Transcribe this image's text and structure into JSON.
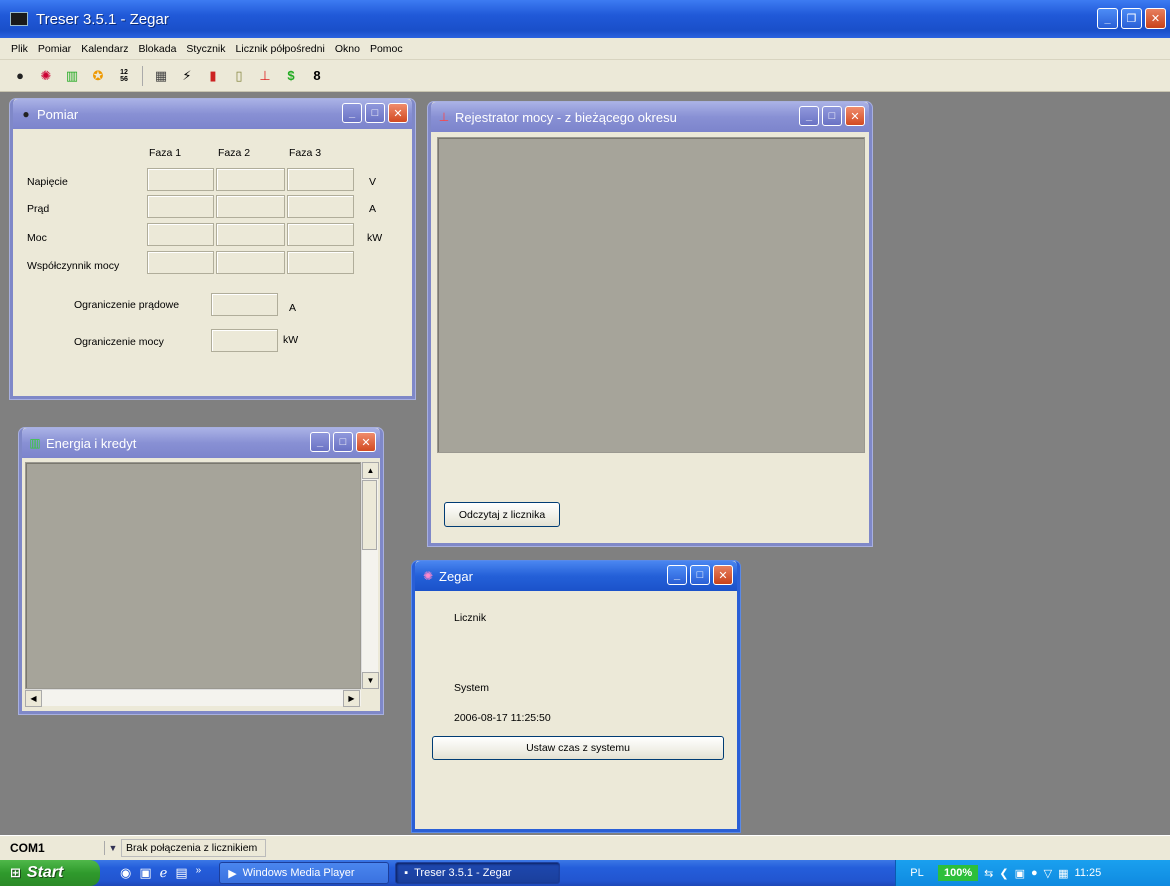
{
  "app": {
    "title": "Treser 3.5.1 - Zegar"
  },
  "menu": [
    "Plik",
    "Pomiar",
    "Kalendarz",
    "Blokada",
    "Stycznik",
    "Licznik półpośredni",
    "Okno",
    "Pomoc"
  ],
  "toolbar_icons": [
    "measure-icon",
    "clock-icon",
    "energy-icon",
    "block-icon",
    "numbers-icon",
    "calendar-icon",
    "switch-icon",
    "chart-icon",
    "battery-icon",
    "power-recorder-icon",
    "dollar-icon",
    "display-icon"
  ],
  "pomiar": {
    "title": "Pomiar",
    "col_headers": [
      "Faza 1",
      "Faza 2",
      "Faza 3"
    ],
    "rows": [
      {
        "label": "Napięcie",
        "unit": "V"
      },
      {
        "label": "Prąd",
        "unit": "A"
      },
      {
        "label": "Moc",
        "unit": "kW"
      },
      {
        "label": "Współczynnik mocy",
        "unit": ""
      }
    ],
    "limit_current_label": "Ograniczenie prądowe",
    "limit_current_unit": "A",
    "limit_power_label": "Ograniczenie mocy",
    "limit_power_unit": "kW"
  },
  "rejestrator": {
    "title": "Rejestrator mocy - z bieżącego okresu",
    "read_button": "Odczytaj z licznika"
  },
  "energia": {
    "title": "Energia i kredyt"
  },
  "zegar": {
    "title": "Zegar",
    "meter_label": "Licznik",
    "system_label": "System",
    "system_time": "2006-08-17 11:25:50",
    "set_button": "Ustaw czas z systemu"
  },
  "status": {
    "port": "COM1",
    "message": "Brak połączenia z licznikiem"
  },
  "taskbar": {
    "start": "Start",
    "tasks": [
      "Windows Media Player",
      "Treser 3.5.1 - Zegar"
    ],
    "lang": "PL",
    "zoom": "100%",
    "time": "11:25"
  }
}
